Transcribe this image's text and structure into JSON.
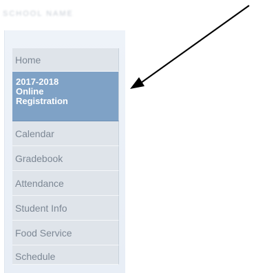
{
  "header": {
    "blurred_text": "SCHOOL NAME"
  },
  "sidebar": {
    "items": [
      {
        "label": "Home"
      },
      {
        "label": "2017-2018\nOnline\nRegistration"
      },
      {
        "label": "Calendar"
      },
      {
        "label": "Gradebook"
      },
      {
        "label": "Attendance"
      },
      {
        "label": "Student Info"
      },
      {
        "label": "Food Service"
      },
      {
        "label": "Schedule"
      }
    ],
    "active_index": 1
  },
  "annotation": {
    "arrow_color": "#000000"
  }
}
